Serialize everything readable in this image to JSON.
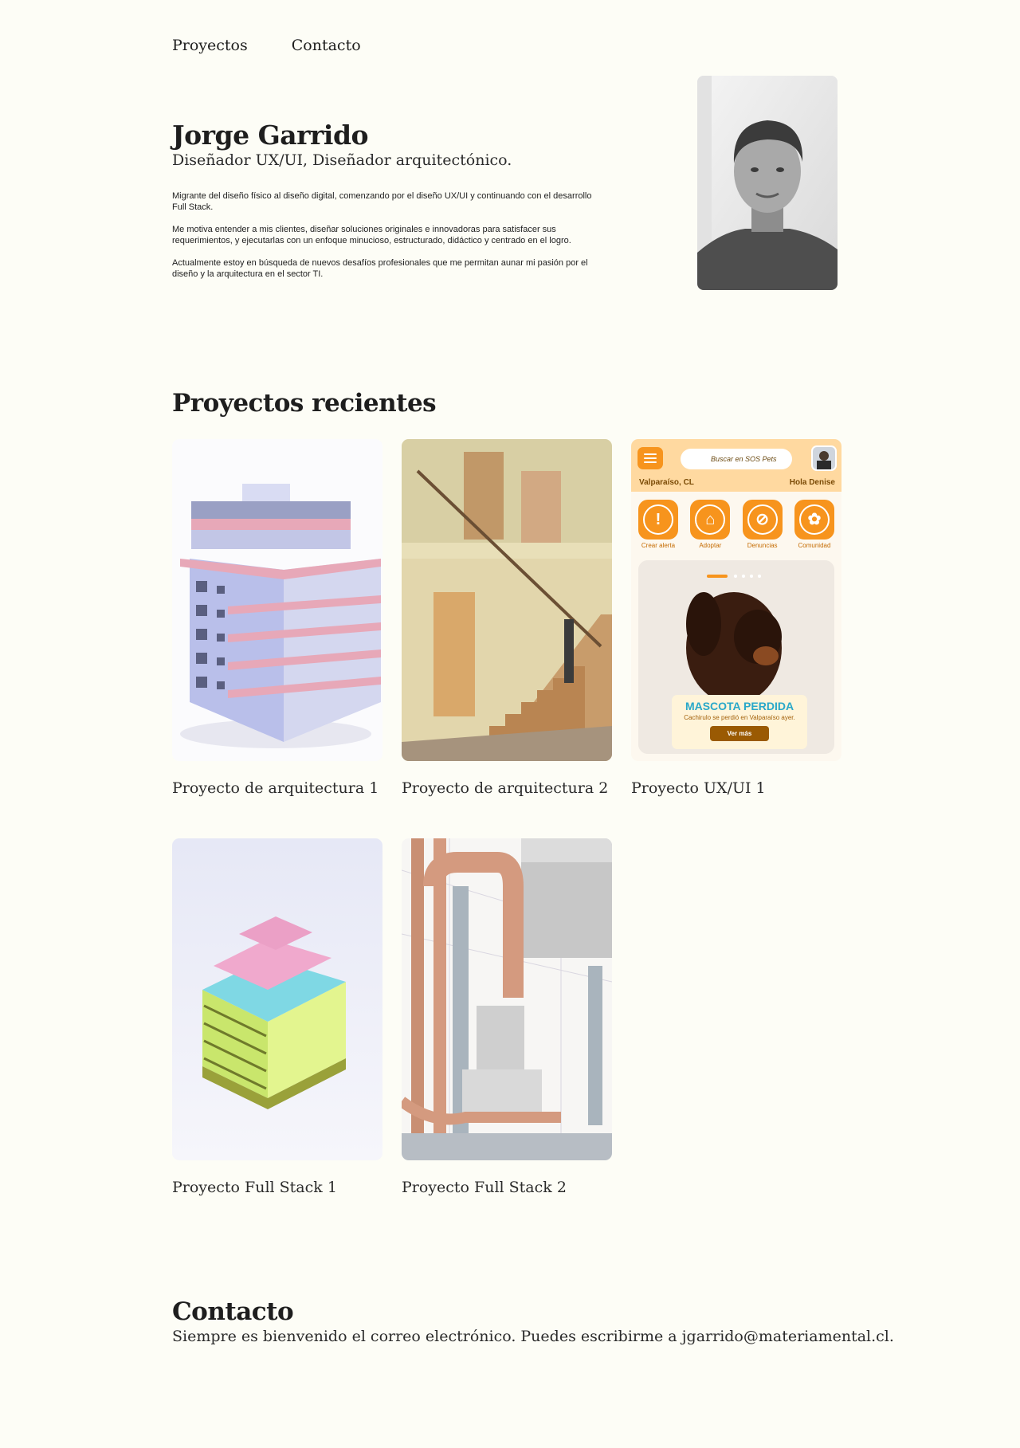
{
  "nav": {
    "projects": "Proyectos",
    "contact": "Contacto"
  },
  "hero": {
    "name": "Jorge Garrido",
    "role": "Diseñador UX/UI, Diseñador arquitectónico.",
    "paragraphs": [
      "Migrante del diseño físico al diseño digital, comenzando por el diseño UX/UI y continuando con el desarrollo Full Stack.",
      "Me motiva entender a mis clientes, diseñar soluciones originales e innovadoras para satisfacer sus requerimientos, y ejecutarlas con un enfoque minucioso, estructurado, didáctico y centrado en el logro.",
      "Actualmente estoy en búsqueda de nuevos desafíos profesionales que me permitan aunar mi pasión por el diseño y la arquitectura en el sector TI."
    ]
  },
  "projects": {
    "title": "Proyectos recientes",
    "items": [
      {
        "caption": "Proyecto de arquitectura 1"
      },
      {
        "caption": "Proyecto de arquitectura 2"
      },
      {
        "caption": "Proyecto UX/UI 1"
      },
      {
        "caption": "Proyecto Full Stack 1"
      },
      {
        "caption": "Proyecto Full Stack 2"
      }
    ]
  },
  "app_mock": {
    "search_placeholder": "Buscar en SOS Pets",
    "location": "Valparaíso, CL",
    "greeting": "Hola Denise",
    "actions": [
      "Crear alerta",
      "Adoptar",
      "Denuncias",
      "Comunidad"
    ],
    "banner_title": "MASCOTA PERDIDA",
    "banner_text": "Cachirulo se perdió en Valparaíso ayer.",
    "banner_button": "Ver más"
  },
  "contact": {
    "title": "Contacto",
    "text": "Siempre es bienvenido el correo electrónico. Puedes escribirme a jgarrido@materiamental.cl."
  }
}
